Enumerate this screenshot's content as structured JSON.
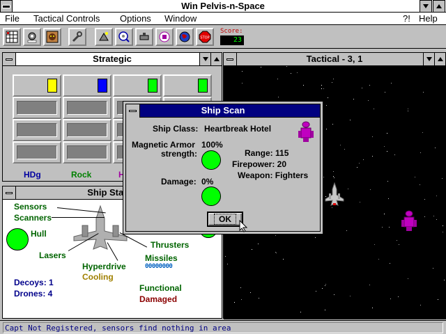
{
  "app": {
    "title": "Win Pelvis-n-Space",
    "colors": {
      "window_bg": "#c0c0c0",
      "dialog_title_bg": "#000080",
      "space": "#000000"
    }
  },
  "menu": {
    "file": "File",
    "tactical": "Tactical Controls",
    "options": "Options",
    "window": "Window",
    "help_q": "?!",
    "help": "Help"
  },
  "toolbar": {
    "icons": [
      "grid-icon",
      "mine-icon",
      "cat-icon",
      "wrench-icon",
      "ship-icon",
      "scan-icon",
      "weapon-icon",
      "fighter-icon",
      "globe-icon",
      "stop-icon"
    ],
    "score_label": "Score:",
    "score_value": "23"
  },
  "strategic": {
    "title": "Strategic",
    "markers": [
      "#ffff00",
      "#0000ff",
      "#00ff00",
      "#00ff00"
    ],
    "footer_hdg": "HDg",
    "footer_rock": "Rock",
    "footer_h": "H",
    "colors": {
      "hdg": "#0000a0",
      "rock": "#008000",
      "h": "#a000a0"
    }
  },
  "ship_status": {
    "title": "Ship Status",
    "sensors": "Sensors",
    "scanners": "Scanners",
    "hull": "Hull",
    "lasers": "Lasers",
    "hyperdrive": "Hyperdrive",
    "cooling": "Cooling",
    "thrusters": "Thrusters",
    "missiles": "Missiles",
    "missiles_count": "00000000",
    "decoys": "Decoys: 1",
    "drones": "Drones: 4",
    "functional": "Functional",
    "damaged": "Damaged",
    "colors": {
      "system": "#006400",
      "yellow": "#a08000",
      "blue": "#00008b",
      "damaged": "#8b0000",
      "missiles": "#0060c0"
    }
  },
  "tactical": {
    "title": "Tactical - 3, 1"
  },
  "dialog": {
    "title": "Ship Scan",
    "ship_class_label": "Ship Class:",
    "ship_class_value": "Heartbreak Hotel",
    "armor_label_1": "Magnetic Armor",
    "armor_label_2": "strength:",
    "armor_value": "100%",
    "range": "Range: 115",
    "firepower": "Firepower: 20",
    "weapon": "Weapon: Fighters",
    "damage_label": "Damage:",
    "damage_value": "0%",
    "ok": "OK"
  },
  "status_bar": {
    "text": "Capt Not Registered, sensors find nothing in area"
  }
}
